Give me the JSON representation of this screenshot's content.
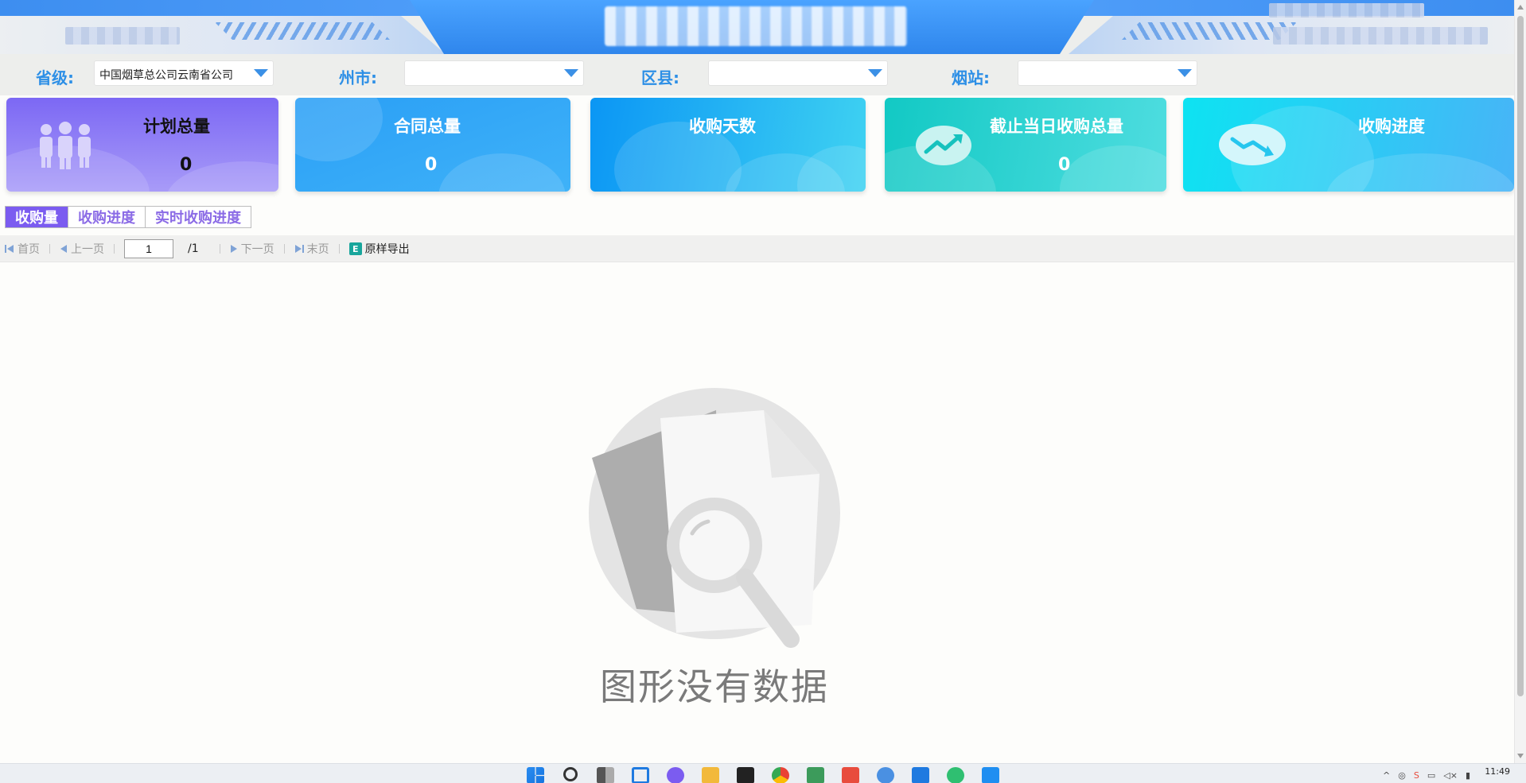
{
  "filters": {
    "province": {
      "label": "省级:",
      "value": "中国烟草总公司云南省公司"
    },
    "city": {
      "label": "州市:",
      "value": ""
    },
    "county": {
      "label": "区县:",
      "value": ""
    },
    "station": {
      "label": "烟站:",
      "value": ""
    }
  },
  "cards": [
    {
      "title": "计划总量",
      "value": "0",
      "icon": "people-icon"
    },
    {
      "title": "合同总量",
      "value": "0",
      "icon": ""
    },
    {
      "title": "收购天数",
      "value": "",
      "icon": ""
    },
    {
      "title": "截止当日收购总量",
      "value": "0",
      "icon": "trend-up-icon"
    },
    {
      "title": "收购进度",
      "value": "",
      "icon": "trend-down-icon"
    }
  ],
  "tabs": [
    {
      "label": "收购量",
      "active": true
    },
    {
      "label": "收购进度",
      "active": false
    },
    {
      "label": "实时收购进度",
      "active": false
    }
  ],
  "pager": {
    "first": "首页",
    "prev": "上一页",
    "current_page": "1",
    "total": "/1",
    "next": "下一页",
    "last": "末页",
    "export": "原样导出"
  },
  "empty_state": {
    "message": "图形没有数据"
  },
  "taskbar": {
    "time": "11:49"
  },
  "colors": {
    "accent_purple": "#7b5cf0",
    "accent_blue": "#2d8fe6",
    "card1": "#8b7cf6",
    "card2": "#2aa6f6",
    "card3": "#18b4f3",
    "card4": "#1ed4cf",
    "card5": "#2fd1f0"
  }
}
